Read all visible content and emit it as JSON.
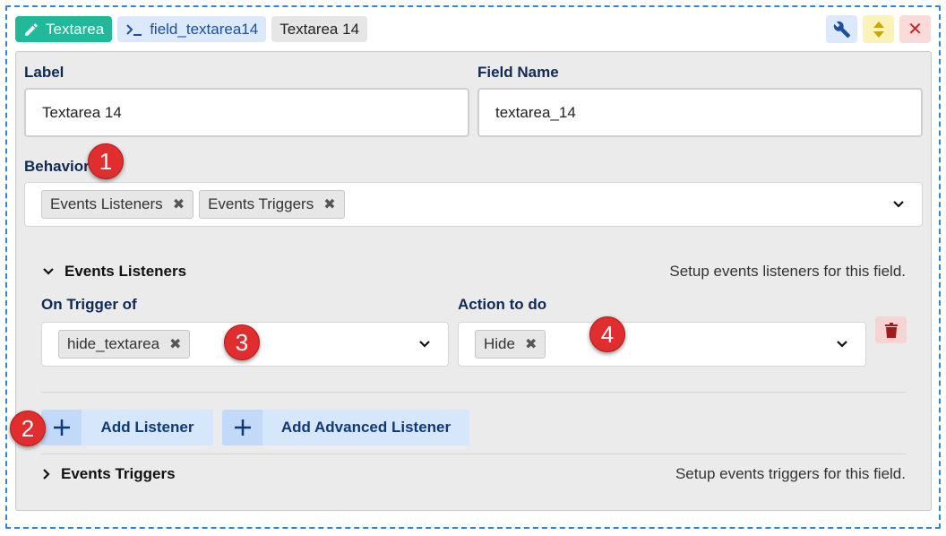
{
  "header": {
    "type_chip": "Textarea",
    "field_chip": "field_textarea14",
    "label_chip": "Textarea 14",
    "tools": {
      "wrench_icon": "wrench-icon",
      "sort_icon": "sort-icon",
      "close_glyph": "✕"
    }
  },
  "form": {
    "label_title": "Label",
    "label_value": "Textarea 14",
    "fieldname_title": "Field Name",
    "fieldname_value": "textarea_14",
    "behaviors_title": "Behaviors",
    "behaviors_tags": [
      "Events Listeners",
      "Events Triggers"
    ],
    "tag_remove_glyph": "✖"
  },
  "listeners": {
    "title": "Events Listeners",
    "description": "Setup events listeners for this field.",
    "trigger_title": "On Trigger of",
    "trigger_tag": "hide_textarea",
    "action_title": "Action to do",
    "action_tag": "Hide",
    "add_listener": "Add Listener",
    "add_advanced": "Add Advanced Listener"
  },
  "triggers": {
    "title": "Events Triggers",
    "description": "Setup events triggers for this field."
  },
  "badges": [
    "1",
    "2",
    "3",
    "4"
  ],
  "colors": {
    "accent": "#22b89a",
    "border_dashed": "#2f86d8",
    "badge": "#e02d2d",
    "primary_text": "#0f2a55"
  }
}
